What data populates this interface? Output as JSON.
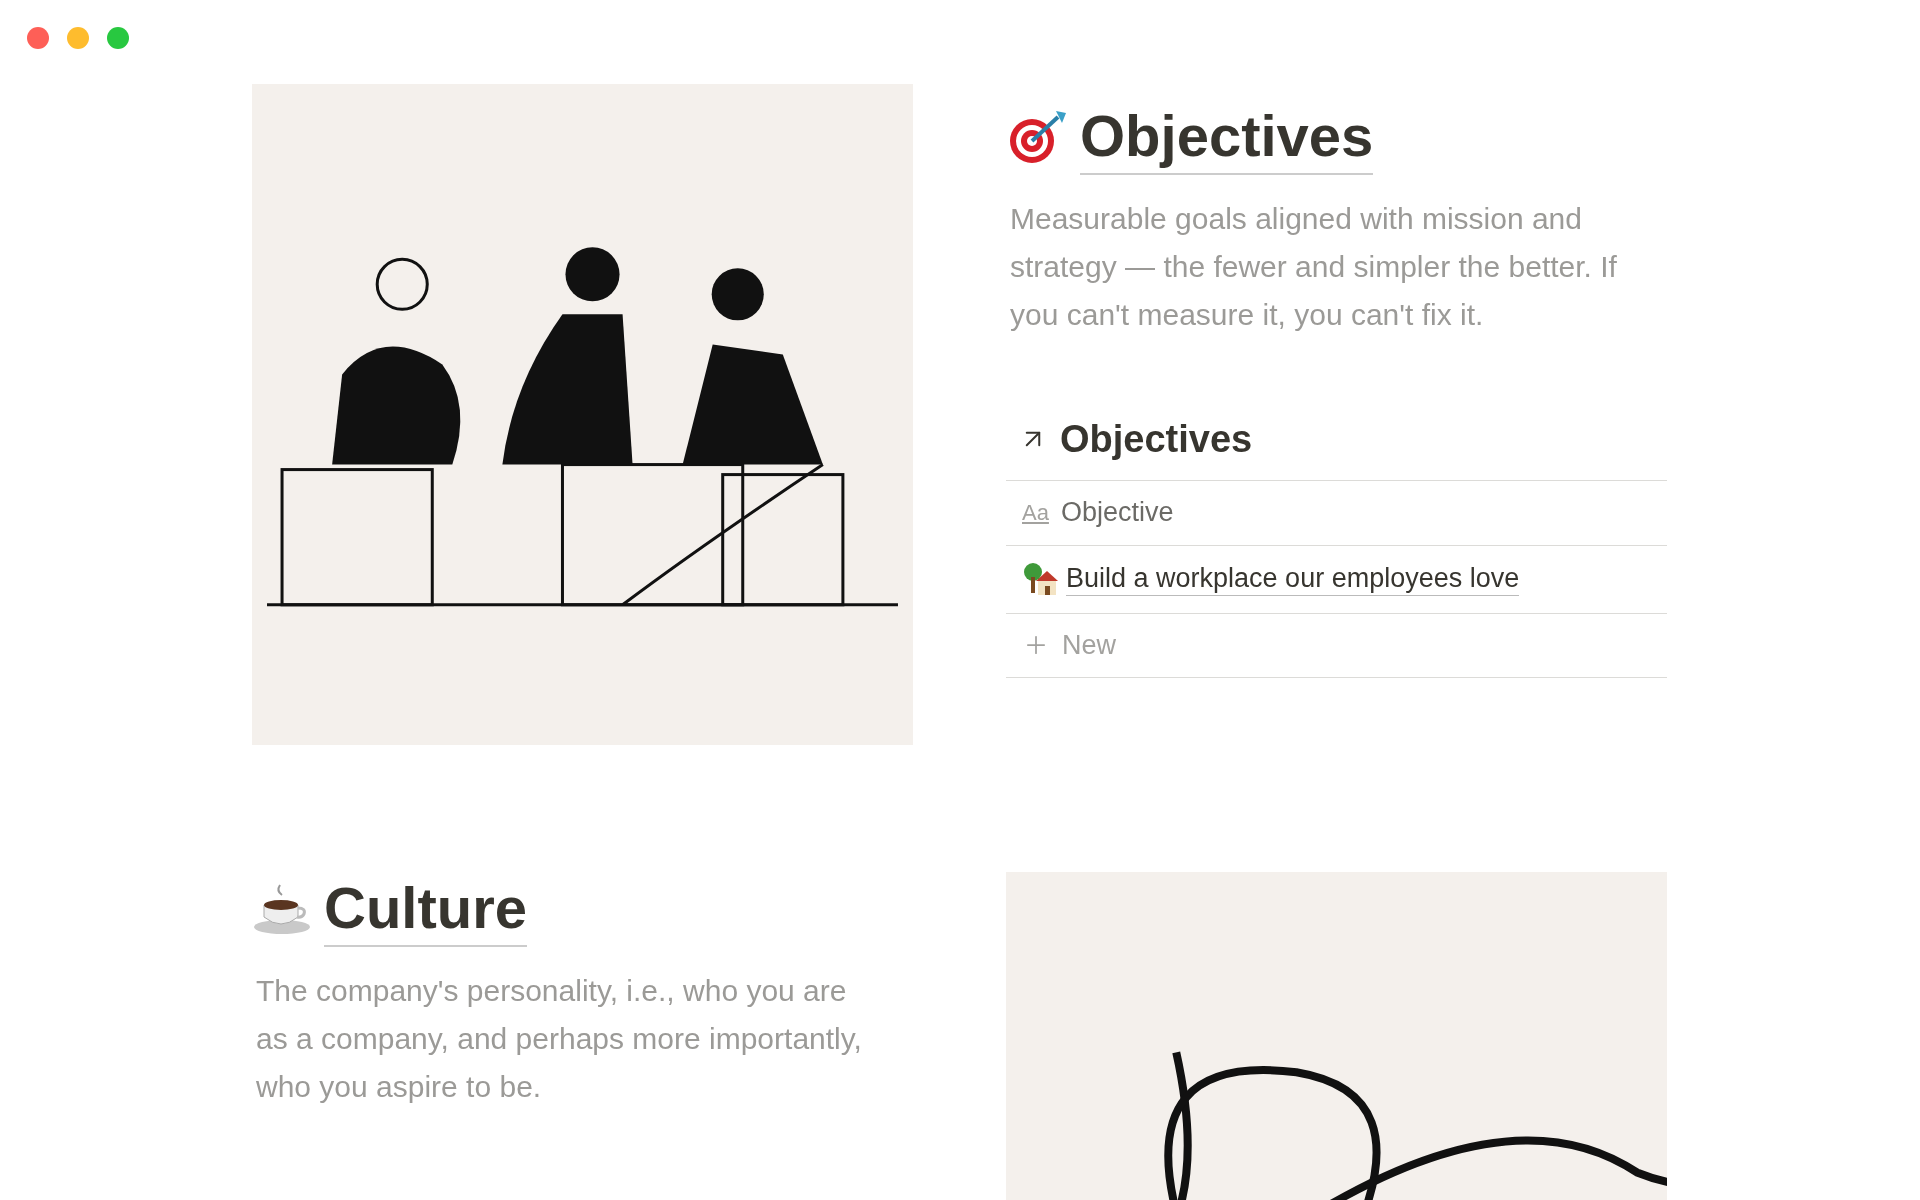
{
  "sections": [
    {
      "title": "Objectives",
      "description": "Measurable goals aligned with mission and strategy — the fewer and simpler the better. If you can't measure it, you can't fix it.",
      "database": {
        "title": "Objectives",
        "column": {
          "icon_text": "Aa",
          "label": "Objective"
        },
        "rows": [
          "Build a workplace our employees love"
        ],
        "new_label": "New"
      }
    },
    {
      "title": "Culture",
      "description": "The company's personality, i.e., who you are as a company, and perhaps more importantly, who you aspire to be."
    }
  ]
}
